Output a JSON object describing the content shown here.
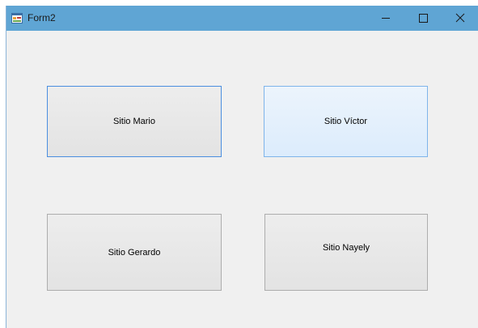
{
  "window": {
    "title": "Form2",
    "icon": "winforms-app-icon",
    "controls": {
      "minimize": "minimize-icon",
      "maximize": "maximize-icon",
      "close": "close-icon"
    },
    "titlebar_color": "#5fa5d4",
    "background_color": "#f0f0f0"
  },
  "buttons": {
    "mario": {
      "label": "Sitio Mario",
      "state": "focused"
    },
    "victor": {
      "label": "Sitio Víctor",
      "state": "hover"
    },
    "gerardo": {
      "label": "Sitio Gerardo",
      "state": "normal"
    },
    "nayely": {
      "label": "Sitio Nayely",
      "state": "normal"
    }
  },
  "colors": {
    "focus_border": "#4a8ee0",
    "hover_border": "#7eb4ea",
    "hover_fill": "#e5f1fb",
    "normal_border": "#adadad",
    "normal_fill": "#e1e1e1"
  }
}
